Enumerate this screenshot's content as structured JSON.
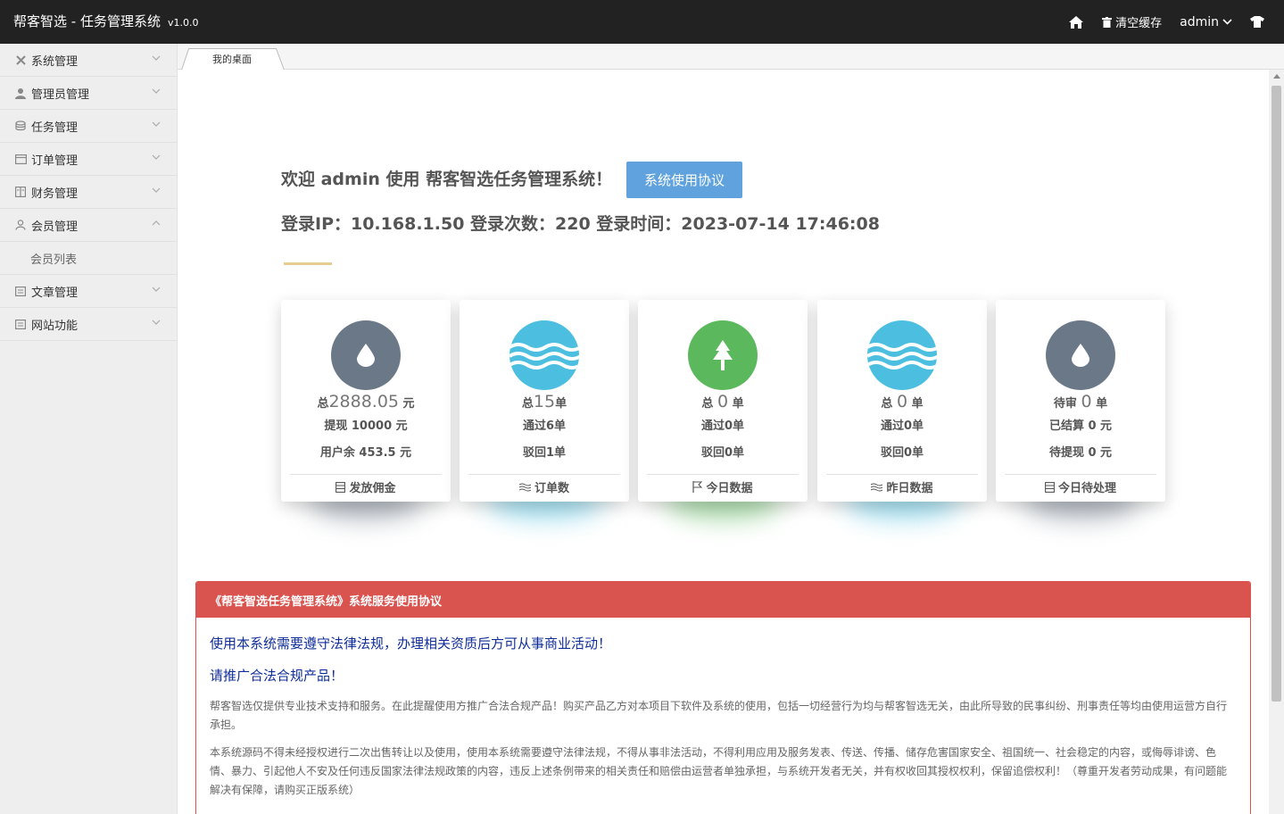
{
  "header": {
    "title": "帮客智选 - 任务管理系统",
    "version": "v1.0.0",
    "home_icon": "home-icon",
    "clear_cache_label": "清空缓存",
    "user_label": "admin",
    "theme_icon": "shirt-icon"
  },
  "sidebar": {
    "items": [
      {
        "label": "系统管理",
        "icon": "tools-icon",
        "expanded": false
      },
      {
        "label": "管理员管理",
        "icon": "user-icon",
        "expanded": false
      },
      {
        "label": "任务管理",
        "icon": "database-icon",
        "expanded": false
      },
      {
        "label": "订单管理",
        "icon": "window-icon",
        "expanded": false
      },
      {
        "label": "财务管理",
        "icon": "book-icon",
        "expanded": false
      },
      {
        "label": "会员管理",
        "icon": "members-icon",
        "expanded": true
      },
      {
        "label": "文章管理",
        "icon": "list-icon",
        "expanded": false
      },
      {
        "label": "网站功能",
        "icon": "list-icon",
        "expanded": false
      }
    ],
    "sub_items": {
      "member": [
        "会员列表"
      ]
    }
  },
  "tabs": [
    {
      "label": "我的桌面"
    }
  ],
  "welcome": {
    "text": "欢迎 admin 使用 帮客智选任务管理系统！",
    "agreement_button": "系统使用协议",
    "login_info": "登录IP：10.168.1.50 登录次数：220 登录时间：2023-07-14 17:46:08"
  },
  "cards": [
    {
      "color": "#6b7887",
      "icon": "drop-icon",
      "l1_prefix": "总",
      "l1_big": "2888.05",
      "l1_suffix": " 元",
      "l2": "提现 10000 元",
      "l3": "用户余 453.5 元",
      "footer_icon": "calendar-icon",
      "footer": "发放佣金"
    },
    {
      "color": "#4cbfe0",
      "icon": "wave-icon",
      "l1_prefix": "总",
      "l1_big": "15",
      "l1_suffix": "单",
      "l2": "通过6单",
      "l3": "驳回1单",
      "footer_icon": "wave-icon",
      "footer": "订单数"
    },
    {
      "color": "#5cb85c",
      "icon": "tree-icon",
      "l1_prefix": "总 ",
      "l1_big": "0",
      "l1_suffix": " 单",
      "l2": "通过0单",
      "l3": "驳回0单",
      "footer_icon": "flag-icon",
      "footer": "今日数据"
    },
    {
      "color": "#4cbfe0",
      "icon": "wave-icon",
      "l1_prefix": "总 ",
      "l1_big": "0",
      "l1_suffix": " 单",
      "l2": "通过0单",
      "l3": "驳回0单",
      "footer_icon": "wave-icon",
      "footer": "昨日数据"
    },
    {
      "color": "#6b7887",
      "icon": "drop-icon",
      "l1_prefix": "待审 ",
      "l1_big": "0",
      "l1_suffix": " 单",
      "l2": "已结算 0 元",
      "l3": "待提现 0 元",
      "footer_icon": "calendar-icon",
      "footer": "今日待处理"
    }
  ],
  "notice": {
    "title": "《帮客智选任务管理系统》系统服务使用协议",
    "line1": "使用本系统需要遵守法律法规，办理相关资质后方可从事商业活动！",
    "line2": "请推广合法合规产品！",
    "para1": "帮客智选仅提供专业技术支持和服务。在此提醒使用方推广合法合规产品！购买产品乙方对本项目下软件及系统的使用，包括一切经营行为均与帮客智选无关，由此所导致的民事纠纷、刑事责任等均由使用运营方自行承担。",
    "para2": "本系统源码不得未经授权进行二次出售转让以及使用，使用本系统需要遵守法律法规，不得从事非法活动，不得利用应用及服务发表、传送、传播、储存危害国家安全、祖国统一、社会稳定的内容，或侮辱诽谤、色情、暴力、引起他人不安及任何违反国家法律法规政策的内容，违反上述条例带来的相关责任和赔偿由运营者单独承担，与系统开发者无关，并有权收回其授权权利，保留追偿权利！（尊重开发者劳动成果，有问题能解决有保障，请购买正版系统）"
  }
}
